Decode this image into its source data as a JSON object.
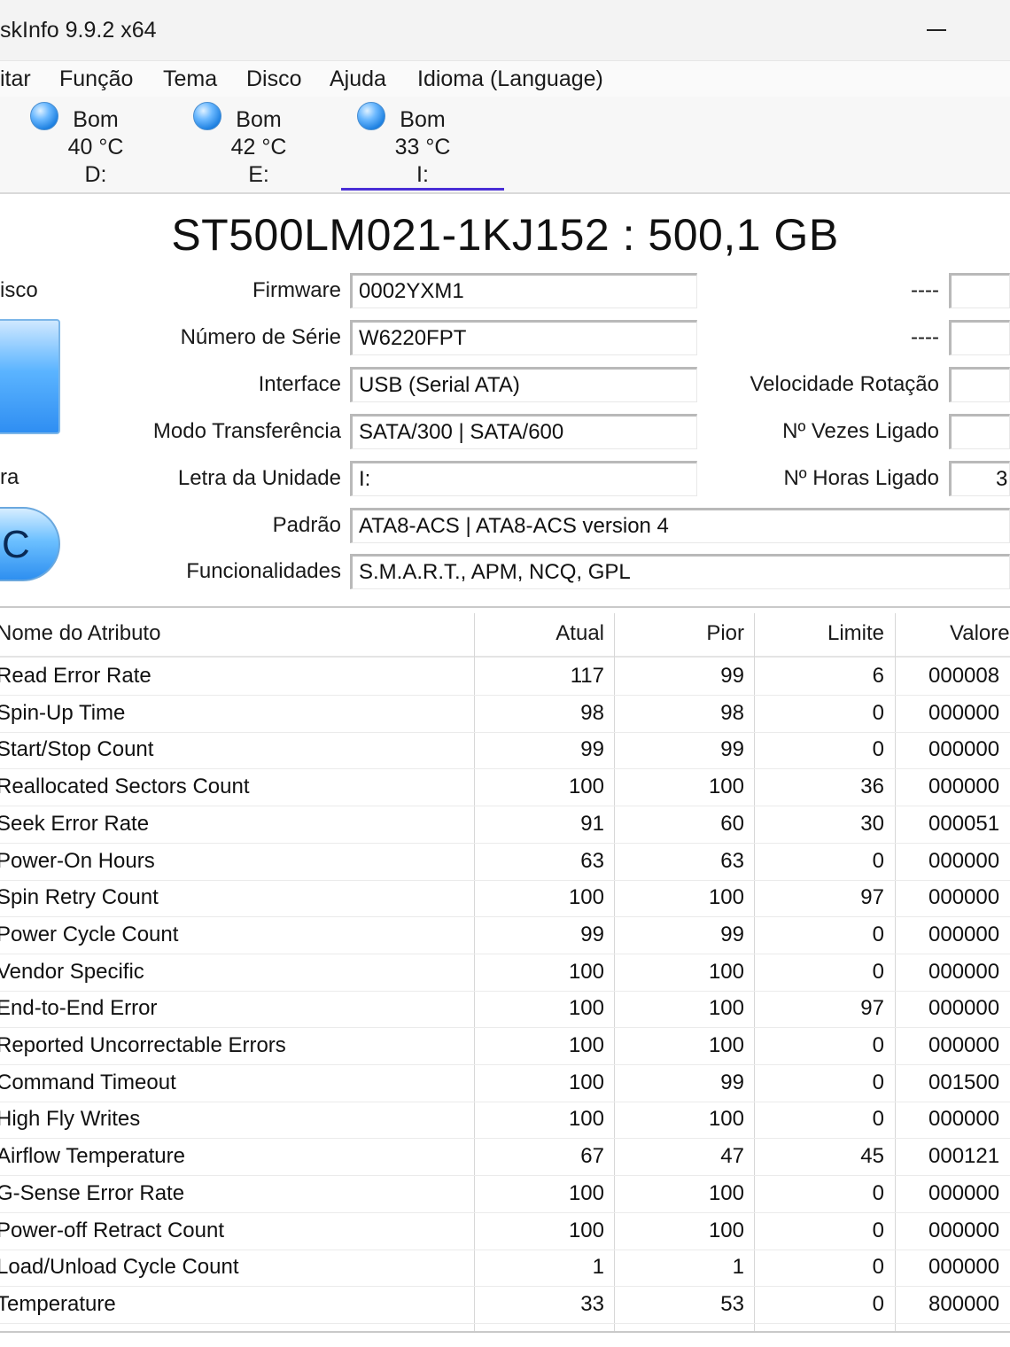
{
  "window": {
    "title": "skInfo 9.9.2 x64"
  },
  "menu": [
    "itar",
    "Função",
    "Tema",
    "Disco",
    "Ajuda",
    "Idioma (Language)"
  ],
  "disks": [
    {
      "status": "Bom",
      "temp": "40 °C",
      "letter": "D:"
    },
    {
      "status": "Bom",
      "temp": "42 °C",
      "letter": "E:"
    },
    {
      "status": "Bom",
      "temp": "33 °C",
      "letter": "I:"
    }
  ],
  "model": "ST500LM021-1KJ152 : 500,1 GB",
  "left_labels": {
    "health": "isco",
    "temp": "ra",
    "temp_badge": "C"
  },
  "info": {
    "firmware_label": "Firmware",
    "firmware": "0002YXM1",
    "serial_label": "Número de Série",
    "serial": "W6220FPT",
    "interface_label": "Interface",
    "interface": "USB (Serial ATA)",
    "transfer_label": "Modo Transferência",
    "transfer": "SATA/300 | SATA/600",
    "drive_letter_label": "Letra da Unidade",
    "drive_letter": "I:",
    "standard_label": "Padrão",
    "standard": "ATA8-ACS | ATA8-ACS version 4",
    "features_label": "Funcionalidades",
    "features": "S.M.A.R.T., APM, NCQ, GPL"
  },
  "right_info": {
    "r1_label": "----",
    "r1_value": "",
    "r2_label": "----",
    "r2_value": "",
    "rotation_label": "Velocidade Rotação",
    "rotation_value": "",
    "power_count_label": "Nº Vezes Ligado",
    "power_count_value": "",
    "power_hours_label": "Nº Horas Ligado",
    "power_hours_value": "3"
  },
  "table": {
    "headers": {
      "name": "Nome do Atributo",
      "atual": "Atual",
      "pior": "Pior",
      "limite": "Limite",
      "valores": "Valore"
    },
    "rows": [
      {
        "name": "Read Error Rate",
        "atual": "117",
        "pior": "99",
        "limite": "6",
        "valor": "000008"
      },
      {
        "name": "Spin-Up Time",
        "atual": "98",
        "pior": "98",
        "limite": "0",
        "valor": "000000"
      },
      {
        "name": "Start/Stop Count",
        "atual": "99",
        "pior": "99",
        "limite": "0",
        "valor": "000000"
      },
      {
        "name": "Reallocated Sectors Count",
        "atual": "100",
        "pior": "100",
        "limite": "36",
        "valor": "000000"
      },
      {
        "name": "Seek Error Rate",
        "atual": "91",
        "pior": "60",
        "limite": "30",
        "valor": "000051"
      },
      {
        "name": "Power-On Hours",
        "atual": "63",
        "pior": "63",
        "limite": "0",
        "valor": "000000"
      },
      {
        "name": "Spin Retry Count",
        "atual": "100",
        "pior": "100",
        "limite": "97",
        "valor": "000000"
      },
      {
        "name": "Power Cycle Count",
        "atual": "99",
        "pior": "99",
        "limite": "0",
        "valor": "000000"
      },
      {
        "name": "Vendor Specific",
        "atual": "100",
        "pior": "100",
        "limite": "0",
        "valor": "000000"
      },
      {
        "name": "End-to-End Error",
        "atual": "100",
        "pior": "100",
        "limite": "97",
        "valor": "000000"
      },
      {
        "name": "Reported Uncorrectable Errors",
        "atual": "100",
        "pior": "100",
        "limite": "0",
        "valor": "000000"
      },
      {
        "name": "Command Timeout",
        "atual": "100",
        "pior": "99",
        "limite": "0",
        "valor": "001500"
      },
      {
        "name": "High Fly Writes",
        "atual": "100",
        "pior": "100",
        "limite": "0",
        "valor": "000000"
      },
      {
        "name": "Airflow Temperature",
        "atual": "67",
        "pior": "47",
        "limite": "45",
        "valor": "000121"
      },
      {
        "name": "G-Sense Error Rate",
        "atual": "100",
        "pior": "100",
        "limite": "0",
        "valor": "000000"
      },
      {
        "name": "Power-off Retract Count",
        "atual": "100",
        "pior": "100",
        "limite": "0",
        "valor": "000000"
      },
      {
        "name": "Load/Unload Cycle Count",
        "atual": "1",
        "pior": "1",
        "limite": "0",
        "valor": "000000"
      },
      {
        "name": "Temperature",
        "atual": "33",
        "pior": "53",
        "limite": "0",
        "valor": "800000"
      }
    ]
  }
}
